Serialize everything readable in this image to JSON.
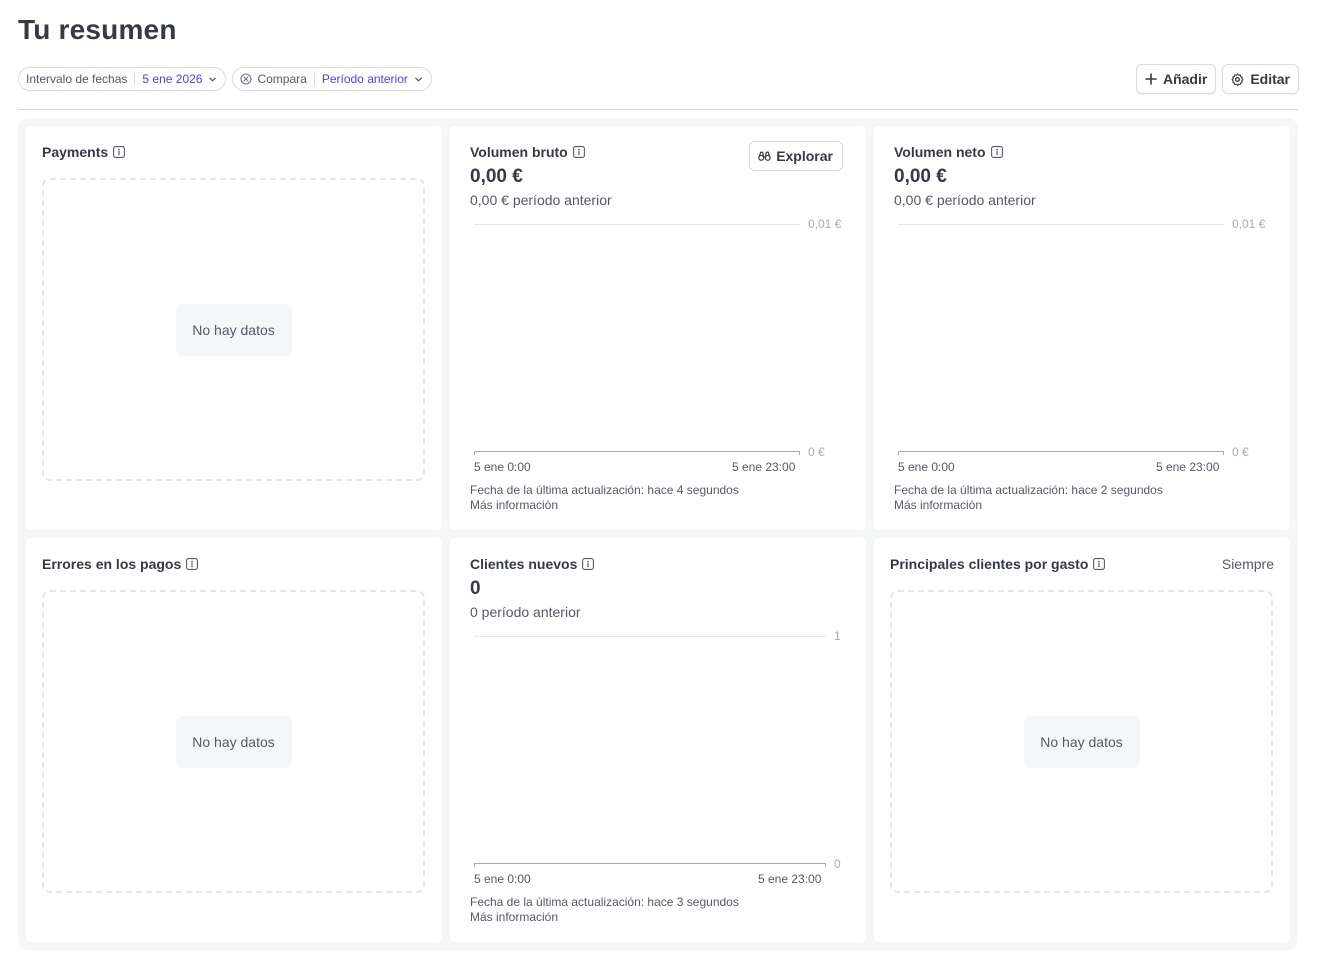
{
  "header": {
    "title": "Tu resumen"
  },
  "filters": {
    "date_range": {
      "label": "Intervalo de fechas",
      "value": "5 ene 2026"
    },
    "compare": {
      "label": "Compara",
      "value": "Período anterior"
    }
  },
  "actions": {
    "add_label": "Añadir",
    "edit_label": "Editar"
  },
  "cards": {
    "payments": {
      "title": "Payments",
      "empty": "No hay datos"
    },
    "gross_volume": {
      "title": "Volumen bruto",
      "explore_label": "Explorar",
      "value": "0,00 €",
      "previous": "0,00 € período anterior",
      "y_max": "0,01 €",
      "y_min": "0 €",
      "x_start": "5 ene 0:00",
      "x_end": "5 ene 23:00",
      "updated": "Fecha de la última actualización: hace 4 segundos",
      "more": "Más información"
    },
    "net_volume": {
      "title": "Volumen neto",
      "value": "0,00 €",
      "previous": "0,00 € período anterior",
      "y_max": "0,01 €",
      "y_min": "0 €",
      "x_start": "5 ene 0:00",
      "x_end": "5 ene 23:00",
      "updated": "Fecha de la última actualización: hace 2 segundos",
      "more": "Más información"
    },
    "payment_errors": {
      "title": "Errores en los pagos",
      "empty": "No hay datos"
    },
    "new_customers": {
      "title": "Clientes nuevos",
      "value": "0",
      "previous": "0 período anterior",
      "y_max": "1",
      "y_min": "0",
      "x_start": "5 ene 0:00",
      "x_end": "5 ene 23:00",
      "updated": "Fecha de la última actualización: hace 3 segundos",
      "more": "Más información"
    },
    "top_customers": {
      "title": "Principales clientes por gasto",
      "period": "Siempre",
      "empty": "No hay datos"
    }
  },
  "icons": {
    "info": "info-icon",
    "chevron": "chevron-down-icon",
    "clear": "close-circle-icon",
    "add": "plus-icon",
    "edit": "gear-icon",
    "explore": "binoculars-icon"
  },
  "colors": {
    "accent": "#533afd",
    "text": "#353a44",
    "muted": "#545969"
  }
}
